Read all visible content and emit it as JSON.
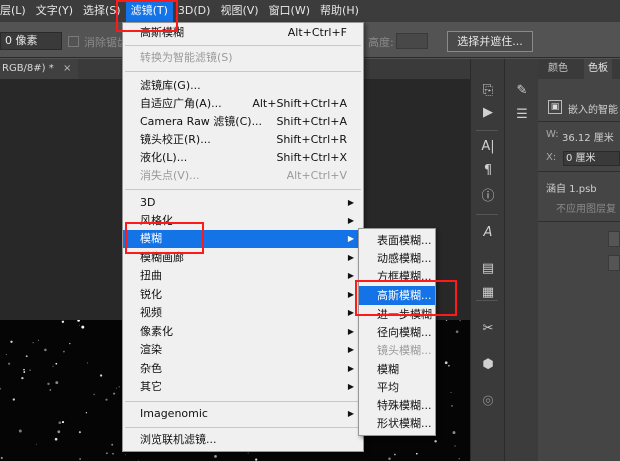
{
  "menubar": {
    "items": [
      "层(L)",
      "文字(Y)",
      "选择(S)",
      "滤镜(T)",
      "3D(D)",
      "视图(V)",
      "窗口(W)",
      "帮助(H)"
    ],
    "active_index": 3
  },
  "optbar": {
    "feather_value": "0 像素",
    "antialias_label": "消除锯齿",
    "height_label": "高度:",
    "select_mask_label": "选择并遮住..."
  },
  "document": {
    "tab_title": "RGB/8#) *",
    "tab_close": "×"
  },
  "filter_menu": {
    "items": [
      {
        "label": "高斯模糊",
        "shortcut": "Alt+Ctrl+F",
        "disabled": false
      },
      {
        "label": "转换为智能滤镜(S)",
        "shortcut": "",
        "disabled": true
      },
      {
        "label": "滤镜库(G)...",
        "shortcut": "",
        "disabled": false
      },
      {
        "label": "自适应广角(A)...",
        "shortcut": "Alt+Shift+Ctrl+A",
        "disabled": false
      },
      {
        "label": "Camera Raw 滤镜(C)...",
        "shortcut": "Shift+Ctrl+A",
        "disabled": false
      },
      {
        "label": "镜头校正(R)...",
        "shortcut": "Shift+Ctrl+R",
        "disabled": false
      },
      {
        "label": "液化(L)...",
        "shortcut": "Shift+Ctrl+X",
        "disabled": false
      },
      {
        "label": "消失点(V)...",
        "shortcut": "Alt+Ctrl+V",
        "disabled": true
      },
      {
        "label": "3D",
        "submenu": true
      },
      {
        "label": "风格化",
        "submenu": true
      },
      {
        "label": "模糊",
        "submenu": true,
        "highlighted": true
      },
      {
        "label": "模糊画廊",
        "submenu": true
      },
      {
        "label": "扭曲",
        "submenu": true
      },
      {
        "label": "锐化",
        "submenu": true
      },
      {
        "label": "视频",
        "submenu": true
      },
      {
        "label": "像素化",
        "submenu": true
      },
      {
        "label": "渲染",
        "submenu": true
      },
      {
        "label": "杂色",
        "submenu": true
      },
      {
        "label": "其它",
        "submenu": true
      },
      {
        "label": "Imagenomic",
        "submenu": true
      },
      {
        "label": "浏览联机滤镜...",
        "submenu": false
      }
    ]
  },
  "blur_submenu": {
    "items": [
      {
        "label": "表面模糊..."
      },
      {
        "label": "动感模糊..."
      },
      {
        "label": "方框模糊..."
      },
      {
        "label": "高斯模糊...",
        "highlighted": true
      },
      {
        "label": "进一步模糊"
      },
      {
        "label": "径向模糊..."
      },
      {
        "label": "镜头模糊...",
        "disabled": true
      },
      {
        "label": "模糊"
      },
      {
        "label": "平均"
      },
      {
        "label": "特殊模糊..."
      },
      {
        "label": "形状模糊..."
      }
    ]
  },
  "right_panel": {
    "tabs": [
      "颜色",
      "色板"
    ],
    "smart_object_label": "嵌入的智能",
    "width_label": "W:",
    "width_value": "36.12 厘米",
    "x_label": "X:",
    "x_value": "0 厘米",
    "layer_name": "涵自 1.psb",
    "apply_layer_comp": "不应用图层复"
  },
  "colors": {
    "accent": "#1473e6",
    "annotation": "#ff1a1a",
    "menu_bg": "#f0f0f0"
  }
}
